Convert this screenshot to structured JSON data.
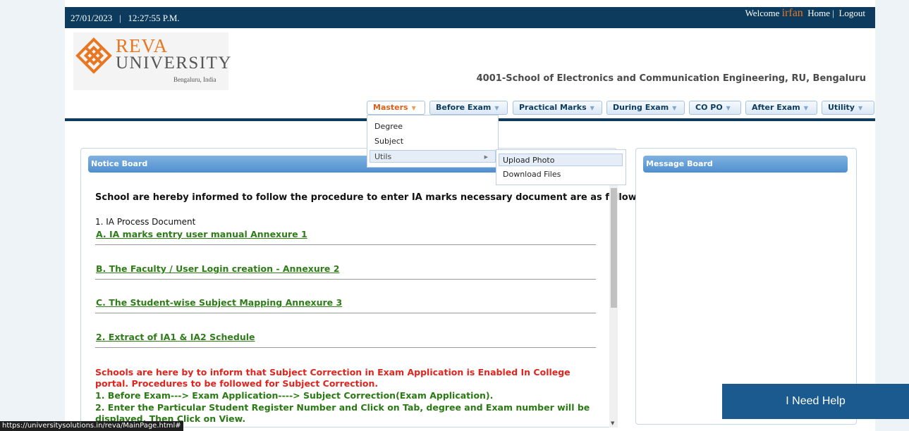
{
  "topbar": {
    "datetime": "27/01/2023   |   12:27:55 P.M.",
    "welcome_prefix": "Welcome",
    "user": "irfan",
    "home": "Home",
    "separator": "|",
    "logout": "Logout"
  },
  "logo": {
    "brand": "REVA",
    "university": "UNIVERSITY",
    "location": "Bengaluru, India"
  },
  "school_name": "4001-School of Electronics and Communication Engineering, RU, Bengaluru",
  "nav": [
    {
      "label": "Masters",
      "active": true
    },
    {
      "label": "Before Exam"
    },
    {
      "label": "Practical Marks"
    },
    {
      "label": "During Exam"
    },
    {
      "label": "CO PO"
    },
    {
      "label": "After Exam"
    },
    {
      "label": "Utility"
    }
  ],
  "masters_menu": {
    "degree": "Degree",
    "subject": "Subject",
    "utils": "Utils"
  },
  "utils_menu": {
    "upload_photo": "Upload Photo",
    "download_files": "Download Files"
  },
  "notice_board": {
    "title": "Notice Board",
    "intro": "School are hereby informed to follow the procedure to enter IA marks necessary document are as follows,",
    "doc_heading": "1. IA Process Document",
    "links": [
      "A. IA marks entry user manual Annexure 1",
      "B. The Faculty / User Login creation - Annexure 2",
      "C. The Student-wise Subject Mapping Annexure 3",
      "2. Extract of IA1 & IA2 Schedule"
    ],
    "red_text": "Schools are here by to inform that Subject Correction in Exam Application is Enabled In College portal. Procedures to be followed for Subject Correction.",
    "step1": "1. Before Exam---> Exam Application----> Subject Correction(Exam Application).",
    "step2": "2. Enter the Particular Student Register Number and Click on Tab, degree and Exam number will be displayed, Then Click on View."
  },
  "message_board": {
    "title": "Message Board"
  },
  "help_button": "I Need Help",
  "status_url": "https://universitysolutions.in/reva/MainPage.html#"
}
